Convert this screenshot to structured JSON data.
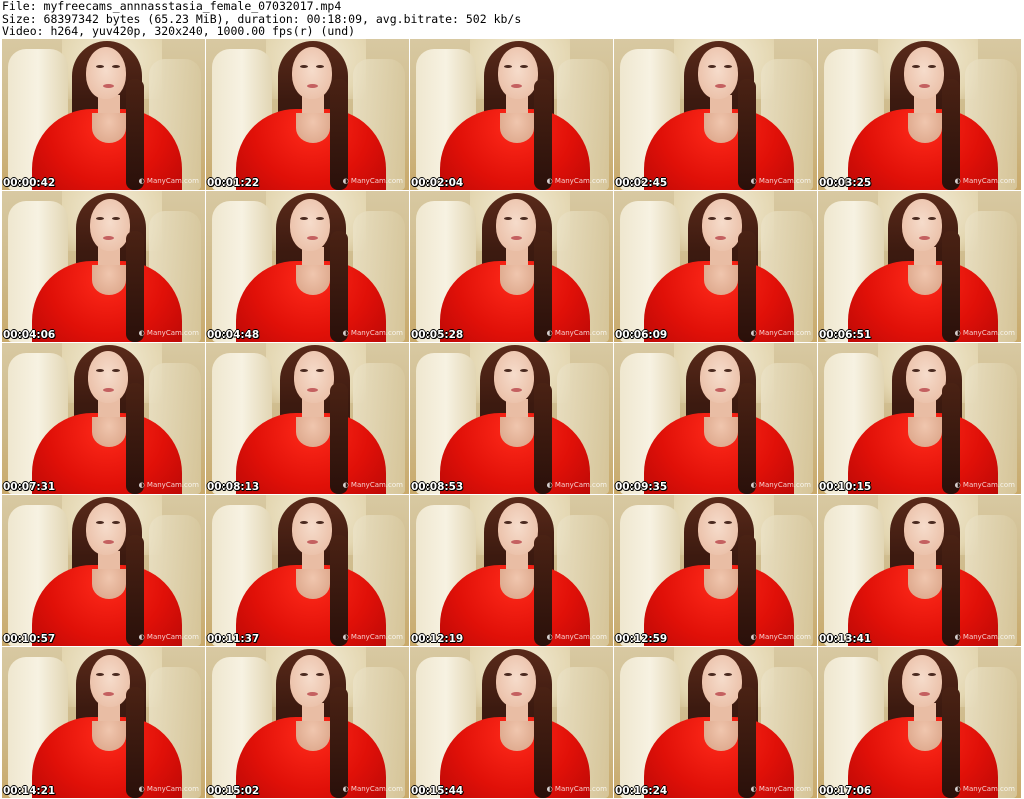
{
  "header": {
    "line1": "File: myfreecams_annnasstasia_female_07032017.mp4",
    "line2": "Size: 68397342 bytes (65.23 MiB), duration: 00:18:09, avg.bitrate: 502 kb/s",
    "line3": "Video: h264, yuv420p, 320x240, 1000.00 fps(r) (und)"
  },
  "watermark": "ManyCam.com",
  "timestamps": [
    "00:00:42",
    "00:01:22",
    "00:02:04",
    "00:02:45",
    "00:03:25",
    "00:04:06",
    "00:04:48",
    "00:05:28",
    "00:06:09",
    "00:06:51",
    "00:07:31",
    "00:08:13",
    "00:08:53",
    "00:09:35",
    "00:10:15",
    "00:10:57",
    "00:11:37",
    "00:12:19",
    "00:12:59",
    "00:13:41",
    "00:14:21",
    "00:15:02",
    "00:15:44",
    "00:16:24",
    "00:17:06"
  ]
}
